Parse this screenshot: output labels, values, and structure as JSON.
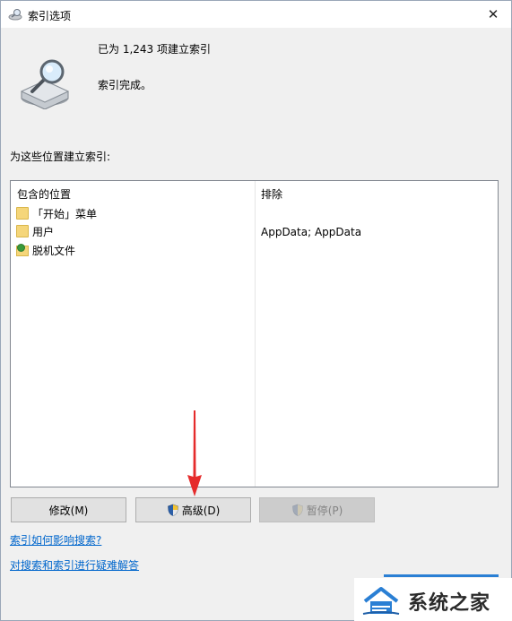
{
  "window": {
    "title": "索引选项",
    "close_glyph": "✕"
  },
  "status": {
    "count_text": "已为 1,243 项建立索引",
    "done_text": "索引完成。"
  },
  "locations": {
    "section_label": "为这些位置建立索引:",
    "col_included": "包含的位置",
    "col_excluded": "排除",
    "rows": [
      {
        "label": "「开始」菜单",
        "exclude": "",
        "icon": "folder-icon"
      },
      {
        "label": "用户",
        "exclude": "AppData; AppData",
        "icon": "folder-icon"
      },
      {
        "label": "脱机文件",
        "exclude": "",
        "icon": "offline-files-icon"
      }
    ]
  },
  "buttons": {
    "modify": "修改(M)",
    "advanced": "高级(D)",
    "pause": "暂停(P)"
  },
  "links": {
    "how_affects": "索引如何影响搜索?",
    "troubleshoot": "对搜索和索引进行疑难解答"
  },
  "watermark": {
    "text": "系统之家"
  },
  "colors": {
    "link": "#0066cc",
    "annotation_arrow": "#e52b2b",
    "watermark_blue": "#2a7fd4"
  }
}
